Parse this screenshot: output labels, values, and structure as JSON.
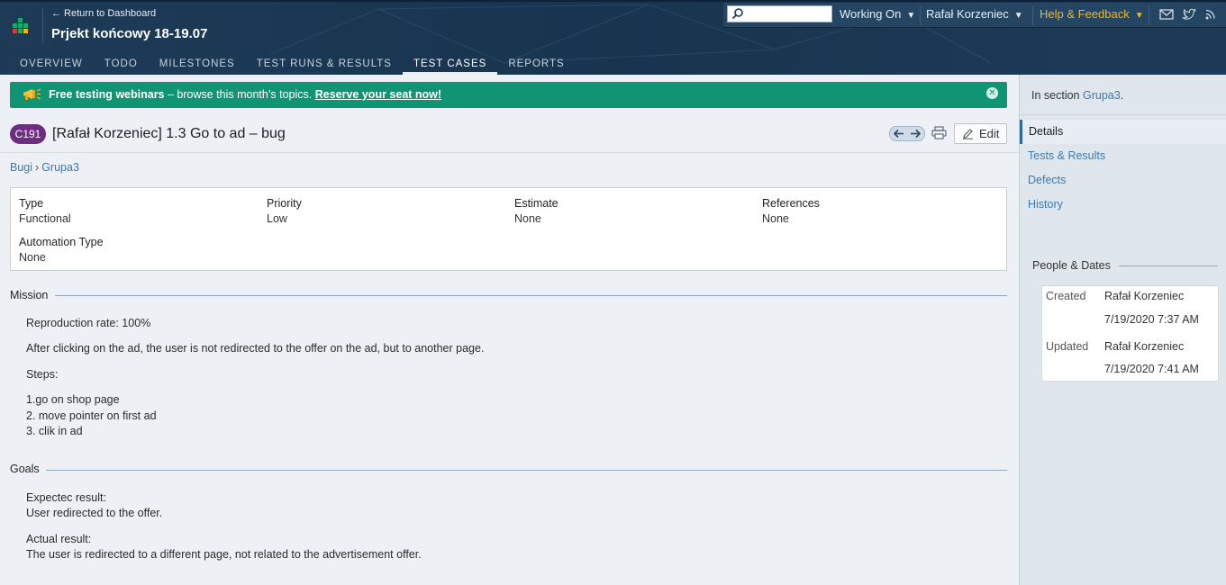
{
  "header": {
    "return_label": "← Return to Dashboard",
    "project_title": "Prjekt końcowy 18-19.07",
    "tabs": [
      {
        "label": "OVERVIEW"
      },
      {
        "label": "TODO"
      },
      {
        "label": "MILESTONES"
      },
      {
        "label": "TEST RUNS & RESULTS"
      },
      {
        "label": "TEST CASES"
      },
      {
        "label": "REPORTS"
      }
    ],
    "active_tab": "TEST CASES",
    "search_placeholder": "",
    "working_on": "Working On",
    "user_name": "Rafał Korzeniec",
    "help": "Help & Feedback",
    "colors": {
      "header_bg": "#1c3a55",
      "help": "#f0b625",
      "accent": "#3a7ab0"
    }
  },
  "banner": {
    "bold_text": "Free testing webinars",
    "text": " – browse this month’s topics. ",
    "link": "Reserve your seat now!",
    "color": "#109474"
  },
  "case": {
    "id": "C191",
    "title": "[Rafał Korzeniec] 1.3 Go to ad – bug",
    "edit_label": "Edit",
    "badge_color": "#6e2c82"
  },
  "breadcrumb": {
    "root": "Bugi",
    "sep": "›",
    "leaf": "Grupa3"
  },
  "fields": {
    "type_label": "Type",
    "type_value": "Functional",
    "priority_label": "Priority",
    "priority_value": "Low",
    "estimate_label": "Estimate",
    "estimate_value": "None",
    "references_label": "References",
    "references_value": "None",
    "automation_label": "Automation Type",
    "automation_value": "None"
  },
  "mission": {
    "heading": "Mission",
    "lines": [
      "Reproduction rate: 100%",
      "After clicking on the ad, the user is not redirected to the offer on the ad, but to another page.",
      "Steps:",
      "1.go on shop page",
      "2. move pointer on first ad",
      "3. clik in ad"
    ]
  },
  "goals": {
    "heading": "Goals",
    "lines": [
      "Expectec result:",
      "User redirected to the offer.",
      "Actual result:",
      "The user is redirected to a different page, not related to the advertisement offer."
    ]
  },
  "sidebar": {
    "in_section_prefix": "In section ",
    "in_section_link": "Grupa3",
    "in_section_suffix": ".",
    "items": [
      {
        "label": "Details"
      },
      {
        "label": "Tests & Results"
      },
      {
        "label": "Defects"
      },
      {
        "label": "History"
      }
    ],
    "people_heading": "People & Dates",
    "created_label": "Created",
    "created_by": "Rafał Korzeniec",
    "created_at": "7/19/2020 7:37 AM",
    "updated_label": "Updated",
    "updated_by": "Rafał Korzeniec",
    "updated_at": "7/19/2020 7:41 AM"
  }
}
